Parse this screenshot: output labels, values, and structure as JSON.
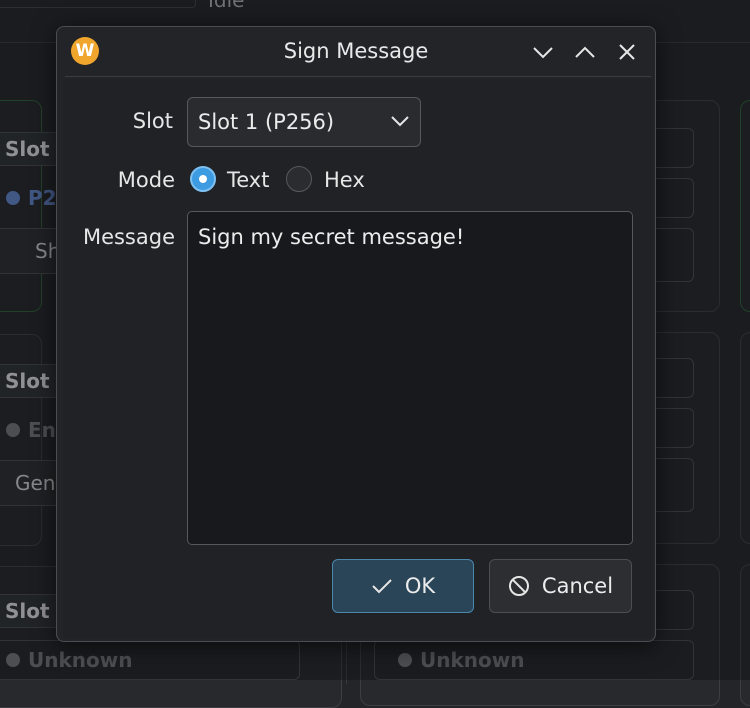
{
  "background": {
    "status_text": "Idle",
    "slot_label": "Slot",
    "chip_p256": "P2",
    "chip_en": "En",
    "chip_unknown": "Unknown",
    "btn_sh": "Sh",
    "btn_gen": "Gen"
  },
  "dialog": {
    "title": "Sign Message",
    "icon_letter": "W",
    "icons": {
      "app": "app-logo-icon",
      "minimize": "chevron-down-icon",
      "maximize": "chevron-up-icon",
      "close": "close-icon"
    }
  },
  "form": {
    "slot_label": "Slot",
    "slot_value": "Slot 1 (P256)",
    "mode_label": "Mode",
    "mode_options": [
      "Text",
      "Hex"
    ],
    "mode_selected": "Text",
    "message_label": "Message",
    "message_value": "Sign my secret message!"
  },
  "buttons": {
    "ok_label": "OK",
    "cancel_label": "Cancel"
  },
  "colors": {
    "accent": "#3d9be2",
    "app_icon": "#f0a52c",
    "ok_bg": "#2b4558"
  }
}
